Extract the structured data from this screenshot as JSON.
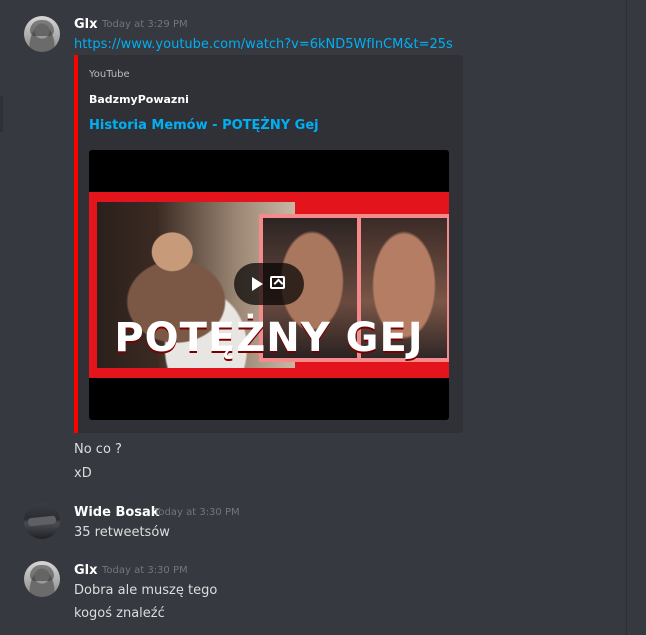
{
  "messages": [
    {
      "username": "Glx",
      "timestamp": "Today at 3:29 PM",
      "avatar_icon": "user-avatar-glx",
      "link": "https://www.youtube.com/watch?v=6kND5WfInCM&t=25s",
      "embed": {
        "provider": "YouTube",
        "author": "BadzmyPowazni",
        "title": "Historia Memów - POTĘŻNY Gej",
        "accent_color": "#ff0000",
        "video_overlay_text": "POTĘŻNY GEJ",
        "play_icon": "play-icon",
        "open_icon": "external-link-icon"
      },
      "followups": [
        "No co ?",
        "xD"
      ]
    },
    {
      "username": "Wide Bosak",
      "timestamp": "Today at 3:30 PM",
      "avatar_icon": "user-avatar-wide",
      "lines": [
        "35 retweetsów"
      ]
    },
    {
      "username": "Glx",
      "timestamp": "Today at 3:30 PM",
      "avatar_icon": "user-avatar-glx",
      "lines": [
        "Dobra ale muszę tego",
        "kogoś znaleźć"
      ]
    }
  ],
  "colors": {
    "background": "#36393f",
    "embed_background": "#2f3136",
    "link": "#00b0f4",
    "username": "#ffffff",
    "timestamp": "#72767d",
    "message_text": "#dcddde"
  }
}
